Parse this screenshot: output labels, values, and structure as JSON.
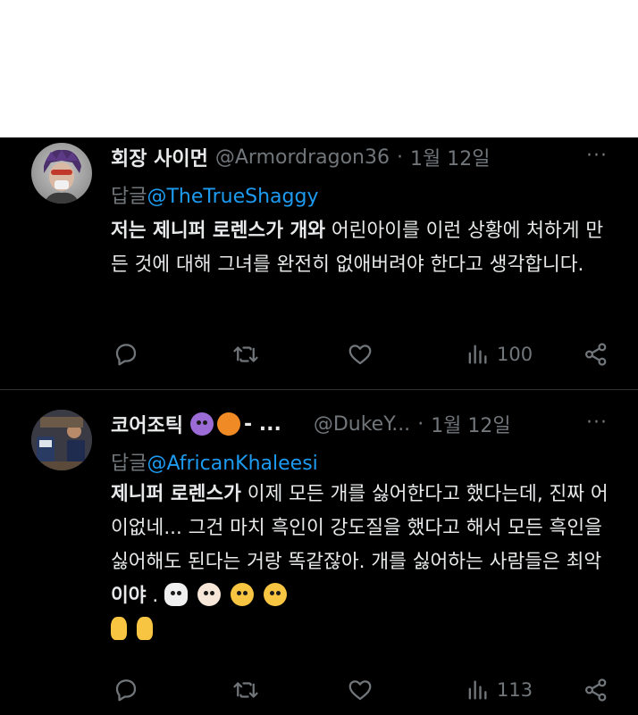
{
  "tweets": [
    {
      "author": {
        "name": "회장 사이먼",
        "handle": "@Armordragon36"
      },
      "date": "1월 12일",
      "more_label": "···",
      "reply_prefix": "답글",
      "reply_to": "@TheTrueShaggy",
      "text_bold": "저는 제니퍼 로렌스가 개와",
      "text_rest": " 어린아이를 이런 상황에 처하게 만든 것에 대해 그녀를 완전히 없애버려야 한다고 생각합니다.",
      "views": "100"
    },
    {
      "author": {
        "name": "코어조틱",
        "name_suffix": "- ...",
        "handle": "@DukeY..."
      },
      "date": "1월 12일",
      "more_label": "···",
      "reply_prefix": "답글",
      "reply_to": "@AfricanKhaleesi",
      "text_bold": "제니퍼 로렌스가",
      "text_rest": " 이제 모든 개를 싫어한다고 했다는데, 진짜 어이없네... 그건 마치 흑인이 강도질을 했다고 해서 모든 흑인을 싫어해도 된다는 거랑 똑같잖아. 개를 싫어하는 사람들은 최악 ",
      "text_bold_2": "이야",
      "text_end": " .",
      "views": "113"
    }
  ],
  "icons": {
    "reply": "reply-icon",
    "retweet": "retweet-icon",
    "like": "heart-icon",
    "views": "views-chart-icon",
    "share": "share-icon"
  },
  "colors": {
    "background": "#000000",
    "text": "#e7e9ea",
    "muted": "#71767b",
    "link": "#1d9bf0",
    "divider": "#2f3336"
  }
}
